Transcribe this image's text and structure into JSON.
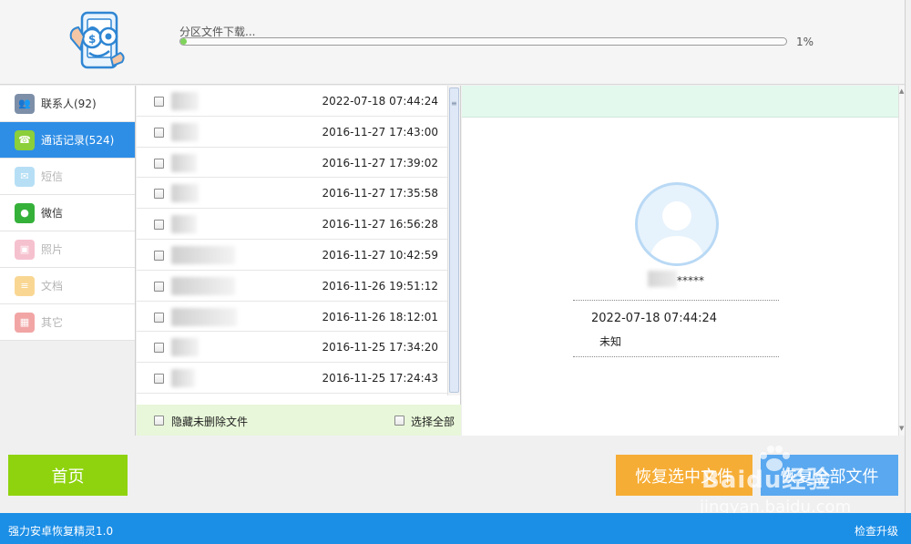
{
  "header": {
    "progress_label": "分区文件下载...",
    "progress_value": 0.01,
    "progress_text": "1%"
  },
  "sidebar": {
    "items": [
      {
        "label": "联系人(92)",
        "icon": "contacts-icon",
        "state": "normal",
        "color": "#7d8fa8"
      },
      {
        "label": "通话记录(524)",
        "icon": "phone-log-icon",
        "state": "active",
        "color": "#8bcf3a"
      },
      {
        "label": "短信",
        "icon": "sms-icon",
        "state": "disabled",
        "color": "#7cc6f0"
      },
      {
        "label": "微信",
        "icon": "wechat-icon",
        "state": "normal",
        "color": "#35b13a"
      },
      {
        "label": "照片",
        "icon": "photo-icon",
        "state": "disabled",
        "color": "#ef8fa8"
      },
      {
        "label": "文档",
        "icon": "document-icon",
        "state": "disabled",
        "color": "#f5b83c"
      },
      {
        "label": "其它",
        "icon": "other-icon",
        "state": "disabled",
        "color": "#e95d5d"
      }
    ]
  },
  "call_list": {
    "rows": [
      {
        "datetime": "2022-07-18 07:44:24"
      },
      {
        "datetime": "2016-11-27 17:43:00"
      },
      {
        "datetime": "2016-11-27 17:39:02"
      },
      {
        "datetime": "2016-11-27 17:35:58"
      },
      {
        "datetime": "2016-11-27 16:56:28"
      },
      {
        "datetime": "2016-11-27 10:42:59"
      },
      {
        "datetime": "2016-11-26 19:51:12"
      },
      {
        "datetime": "2016-11-26 18:12:01"
      },
      {
        "datetime": "2016-11-25 17:34:20"
      },
      {
        "datetime": "2016-11-25 17:24:43"
      }
    ],
    "hide_undeleted_label": "隐藏未删除文件",
    "select_all_label": "选择全部"
  },
  "detail": {
    "contact_masked": "*****",
    "datetime": "2022-07-18 07:44:24",
    "status": "未知"
  },
  "actions": {
    "home_label": "首页",
    "recover_selected_label": "恢复选中文件",
    "recover_all_label": "恢复全部文件"
  },
  "watermark": {
    "main": "Baidu经验",
    "sub": "jingyan.baidu.com"
  },
  "statusbar": {
    "app_name": "强力安卓恢复精灵1.0",
    "check_update": "检查升级"
  }
}
